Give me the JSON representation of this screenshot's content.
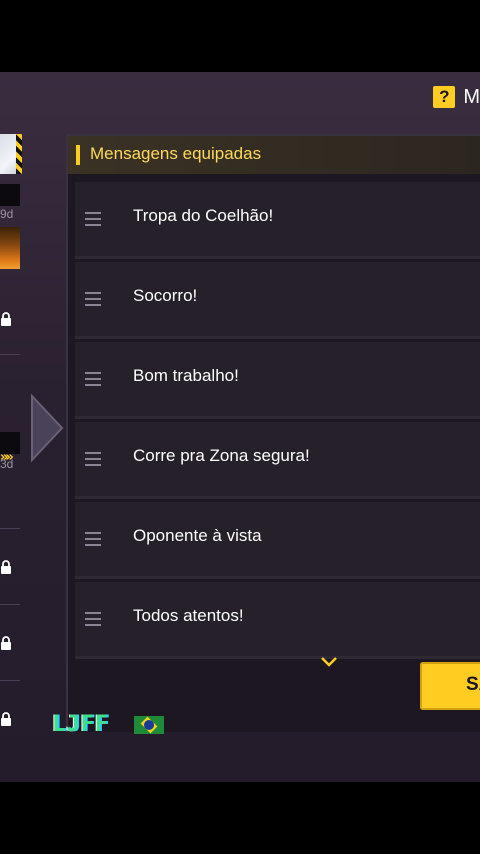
{
  "header": {
    "help_icon": "?",
    "title_fragment": "M"
  },
  "left_strip": {
    "days_1": "9d",
    "days_2": "3d"
  },
  "panel": {
    "title": "Mensagens equipadas",
    "messages": [
      "Tropa do Coelhão!",
      "Socorro!",
      "Bom trabalho!",
      "Corre pra Zona segura!",
      "Oponente à vista",
      "Todos atentos!"
    ]
  },
  "save_button": {
    "label": "SA"
  },
  "watermark": {
    "text": "LJFF"
  },
  "colors": {
    "accent": "#ffcc22",
    "panel_bg": "#1c1720",
    "row_bg": "#252029",
    "title": "#ffd95a"
  }
}
